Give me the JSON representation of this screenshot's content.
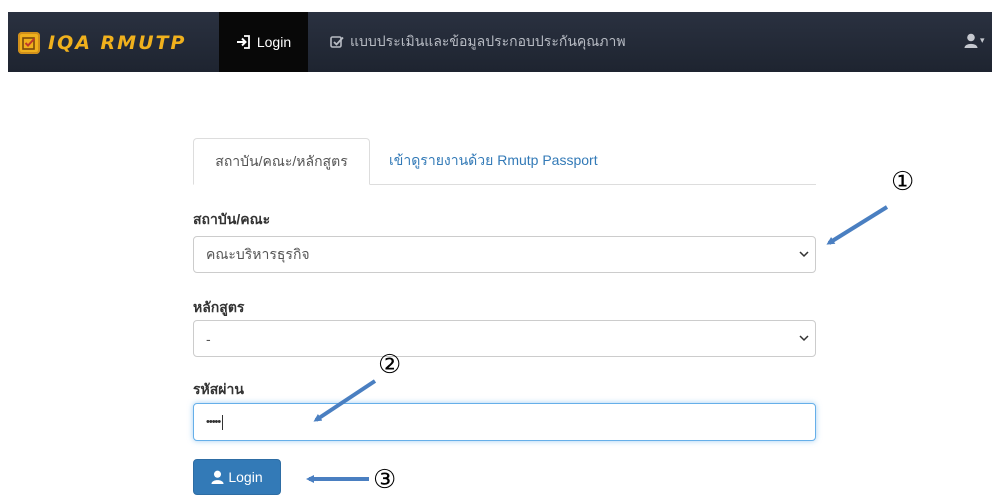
{
  "navbar": {
    "brand": "IQA RMUTP",
    "login_label": "Login",
    "assessment_label": "แบบประเมินและข้อมูลประกอบประกันคุณภาพ",
    "icons": [
      "brand-logo-icon",
      "sign-in-icon",
      "check-square-icon",
      "user-icon",
      "caret-down-icon"
    ],
    "colors": {
      "background": "#222a36",
      "brand": "#f0b11d",
      "active": "#080808"
    }
  },
  "tabs": {
    "active": "สถาบัน/คณะ/หลักสูตร",
    "passport": "เข้าดูรายงานด้วย Rmutp Passport"
  },
  "form": {
    "faculty_label": "สถาบัน/คณะ",
    "faculty_value": "คณะบริหารธุรกิจ",
    "program_label": "หลักสูตร",
    "program_value": "-",
    "password_label": "รหัสผ่าน",
    "password_value": "•••••",
    "login_button": "Login",
    "colors": {
      "primary": "#337ab7",
      "focus": "#66afe9"
    }
  },
  "annotations": {
    "marker_1": "①",
    "marker_2": "②",
    "marker_3": "③",
    "arrow_color": "#4a7fc1"
  }
}
